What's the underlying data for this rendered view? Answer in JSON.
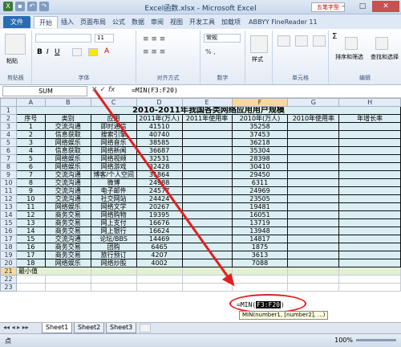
{
  "window": {
    "title": "Excel函数.xlsx - Microsoft Excel",
    "stamp": "五笔字型",
    "controls": [
      "–",
      "□",
      "✕"
    ]
  },
  "ribbon_tabs": [
    "文件",
    "开始",
    "插入",
    "页面布局",
    "公式",
    "数据",
    "审阅",
    "视图",
    "开发工具",
    "加载项",
    "ABBYY FineReader 11"
  ],
  "ribbon_groups": {
    "clipboard": "剪贴板",
    "font": "字体",
    "alignment": "对齐方式",
    "number": "数字",
    "cells": "单元格",
    "editing": "编辑",
    "number_format": "常规",
    "font_size": "11",
    "paste": "粘贴",
    "style": "样式",
    "sort_filter": "排序和筛选",
    "find_select": "查找和选择"
  },
  "formula_bar": {
    "name_box": "SUM",
    "fx": "fx",
    "formula": "=MIN(F3:F20)"
  },
  "columns": [
    "A",
    "B",
    "C",
    "D",
    "E",
    "F",
    "G",
    "H"
  ],
  "sheet": {
    "title": "2010-2011年我国各类网络应用用户规模",
    "headers": [
      "序号",
      "类别",
      "应用",
      "2011年(万人)",
      "2011年使用率",
      "2010年(万人)",
      "2010年使用率",
      "年增长率"
    ],
    "rows": [
      [
        "1",
        "交流沟通",
        "即时通信",
        "41510",
        "",
        "35258"
      ],
      [
        "2",
        "信息获取",
        "搜索引擎",
        "40740",
        "",
        "37453"
      ],
      [
        "3",
        "网络娱乐",
        "网络音乐",
        "38585",
        "",
        "36218"
      ],
      [
        "4",
        "信息获取",
        "网络新闻",
        "36687",
        "",
        "35304"
      ],
      [
        "5",
        "网络娱乐",
        "网络视频",
        "32531",
        "",
        "28398"
      ],
      [
        "6",
        "网络娱乐",
        "网络游戏",
        "32428",
        "",
        "30410"
      ],
      [
        "7",
        "交流沟通",
        "博客/个人空间",
        "31864",
        "",
        "29450"
      ],
      [
        "8",
        "交流沟通",
        "微博",
        "24988",
        "",
        "6311"
      ],
      [
        "9",
        "交流沟通",
        "电子邮件",
        "24577",
        "",
        "24969"
      ],
      [
        "10",
        "交流沟通",
        "社交网站",
        "24424",
        "",
        "23505"
      ],
      [
        "11",
        "网络娱乐",
        "网络文学",
        "20267",
        "",
        "19481"
      ],
      [
        "12",
        "商务交易",
        "网络购物",
        "19395",
        "",
        "16051"
      ],
      [
        "13",
        "商务交易",
        "网上支付",
        "16676",
        "",
        "13719"
      ],
      [
        "14",
        "商务交易",
        "网上银行",
        "16624",
        "",
        "13948"
      ],
      [
        "15",
        "交流沟通",
        "论坛/BBS",
        "14469",
        "",
        "14817"
      ],
      [
        "16",
        "商务交易",
        "团购",
        "6465",
        "",
        "1875"
      ],
      [
        "17",
        "商务交易",
        "旅行预订",
        "4207",
        "",
        "3613"
      ],
      [
        "18",
        "网络娱乐",
        "网络炒股",
        "4002",
        "",
        "7088"
      ]
    ],
    "min_label": "最小值",
    "editing_cell": {
      "prefix": "=MIN(",
      "range": "F3:F20",
      "suffix": ")"
    },
    "tooltip": "MIN(number1, [number2], ...)"
  },
  "row_numbers": [
    "1",
    "2",
    "3",
    "4",
    "5",
    "6",
    "7",
    "8",
    "9",
    "10",
    "11",
    "12",
    "13",
    "14",
    "15",
    "16",
    "17",
    "18",
    "19",
    "20",
    "21",
    "22",
    "23"
  ],
  "sheet_tabs": [
    "Sheet1",
    "Sheet2",
    "Sheet3"
  ],
  "status": {
    "mode": "点",
    "zoom": "100%"
  }
}
